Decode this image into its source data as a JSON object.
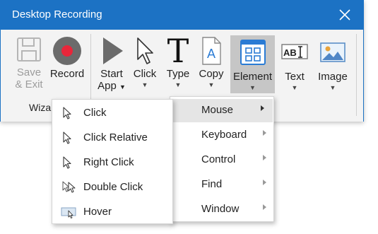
{
  "window": {
    "title": "Desktop Recording"
  },
  "ribbon": {
    "save_exit": {
      "line1": "Save",
      "line2": "& Exit"
    },
    "record": {
      "label": "Record"
    },
    "group_label": "Wiza",
    "start_app": {
      "line1": "Start",
      "line2": "App"
    },
    "click": {
      "label": "Click"
    },
    "type": {
      "label": "Type"
    },
    "copy": {
      "label": "Copy"
    },
    "element": {
      "label": "Element"
    },
    "text": {
      "label": "Text"
    },
    "image": {
      "label": "Image"
    }
  },
  "element_menu": {
    "items": [
      {
        "label": "Mouse"
      },
      {
        "label": "Keyboard"
      },
      {
        "label": "Control"
      },
      {
        "label": "Find"
      },
      {
        "label": "Window"
      }
    ]
  },
  "mouse_menu": {
    "items": [
      {
        "label": "Click",
        "icon": "cursor-icon"
      },
      {
        "label": "Click Relative",
        "icon": "cursor-icon"
      },
      {
        "label": "Right Click",
        "icon": "cursor-icon"
      },
      {
        "label": "Double Click",
        "icon": "double-cursor-icon"
      },
      {
        "label": "Hover",
        "icon": "hover-icon"
      }
    ]
  },
  "colors": {
    "titlebar": "#1c72c4",
    "record_red": "#e8263a",
    "active_button": "#c6c6c6",
    "menu_highlight": "#e5e5e5"
  }
}
